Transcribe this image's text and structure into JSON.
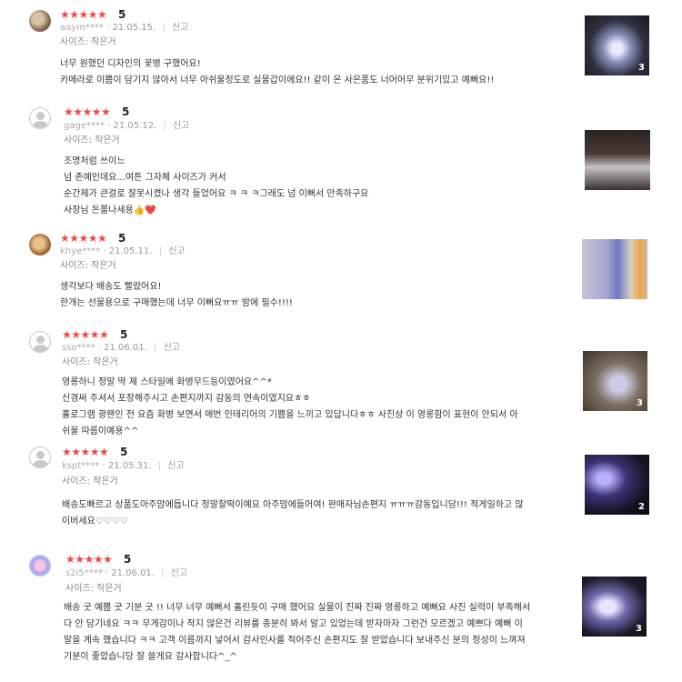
{
  "rating_display": "★★★★★",
  "separator": "|",
  "report_label": "신고",
  "accent_color": "#f04848",
  "reviews": [
    {
      "score": "5",
      "user": "aaym****",
      "date": "21.05.15.",
      "size": "사이즈: 작은거",
      "lines": [
        "너무 원했던 디자인의 꽃병 구했어요!",
        "카메라로 이쁨이 담기지 않아서 너무 아쉬울정도로 실물갑이에요!! 같이 온 사은품도 너어어무 분위기있고 예뻐요!!"
      ],
      "image_count": "3",
      "avatar": "profile-photo"
    },
    {
      "score": "5",
      "user": "gage****",
      "date": "21.05.12.",
      "size": "사이즈: 작은거",
      "lines": [
        "조명처럼 쓰이느",
        "넘 존예인데요...여튼 그자체 사이즈가 커서",
        "순간제가 큰걸로 잘못시켰나 생각 들었어요 ㅋ ㅋ ㅋ그래도 넘 이뻐서 만족하구요",
        "사장님 돈쫄나세용👍❤️"
      ],
      "image_count": "",
      "avatar": "default"
    },
    {
      "score": "5",
      "user": "khye****",
      "date": "21.05.11.",
      "size": "사이즈: 작은거",
      "lines": [
        "생각보다 배송도 빨랐어요!",
        "한개는 선물용으로 구매했는데 너무 이뻐요ㅠㅠ 밤에 필수!!!!"
      ],
      "image_count": "",
      "avatar": "profile-photo"
    },
    {
      "score": "5",
      "user": "sso****",
      "date": "21.06.01.",
      "size": "사이즈: 작은거",
      "lines": [
        "영롱하니 정말 딱 제 스타일에 화병무드등이였어요^^*",
        "신경써 주셔서 포장해주시고 손편지까지 감동의 연속이였지요ㅎㅎ",
        "홀로그램 광팬인 전 요즘 화병 보면서 매번 인테리어의 기쁨을 느끼고 있답니다ㅎㅎ 사진상 이 영롱함이 표현이 안되서 아",
        "쉬울 따름이예용^^"
      ],
      "image_count": "3",
      "avatar": "default"
    },
    {
      "score": "5",
      "user": "kspt****",
      "date": "21.05.31.",
      "size": "사이즈: 작은거",
      "lines": [
        "배송도빠르고 상품도아주맘에듭니다 정말찰떡이예요 아주맘에들어여! 판매자님손편지 ㅠㅠㅠ감동입니담!!! 적게일하고 많",
        "이버세요♡♡♡♡"
      ],
      "image_count": "2",
      "avatar": "default"
    },
    {
      "score": "5",
      "user": "s2i5****",
      "date": "21.06.01.",
      "size": "사이즈: 작은거",
      "lines": [
        "배송 굿 예쁨 굿 기분 굿 !! 너무 너무 예뻐서 홀린듯이 구매 했어요 실물이 진짜 진짜 영롱하고 예뻐요 사진 실력이 부족해서",
        "다 안 담기네요 ㅋㅋ 무게감이나 작지 않은건 리뷰를 충분히 봐서 알고 있었는데 받자마자 그런건 모르겠고 예쁘다 예뻐 이",
        "말을 계속 했습니다 ㅋㅋ 고객 이름까지 넣어서 감사인사를 적어주신 손편지도 잘 받았습니다 보내주신 분의 정성이 느껴져",
        "기분이 좋았습니당 잘 쓸게요 감사합니다^_^"
      ],
      "image_count": "3",
      "avatar": "profile-photo"
    }
  ]
}
